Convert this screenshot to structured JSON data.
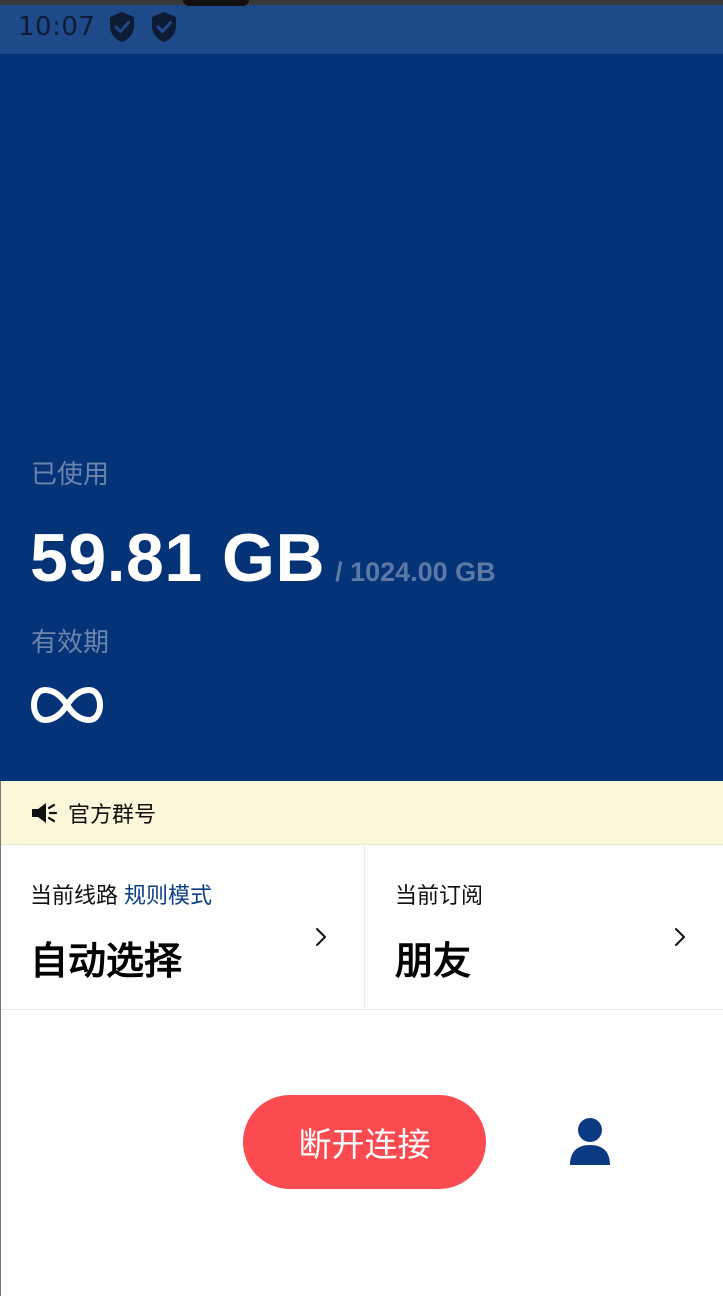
{
  "status_bar": {
    "time": "10:07",
    "icons": [
      "shield-check-icon",
      "shield-check-icon"
    ]
  },
  "usage": {
    "used_label": "已使用",
    "used_value": "59.81 GB",
    "total": "/ 1024.00 GB",
    "validity_label": "有效期",
    "validity_icon": "infinity-icon"
  },
  "notice": {
    "icon": "speaker-icon",
    "text": "官方群号"
  },
  "route_card": {
    "label": "当前线路",
    "mode": "规则模式",
    "value": "自动选择"
  },
  "subscription_card": {
    "label": "当前订阅",
    "value": "朋友"
  },
  "actions": {
    "disconnect_label": "断开连接",
    "profile_icon": "user-icon"
  },
  "colors": {
    "hero_bg": "#043377",
    "status_bg": "#1f4a8a",
    "notice_bg": "#fdf7da",
    "disconnect_bg": "#fb4a50",
    "accent": "#0d3f86"
  }
}
